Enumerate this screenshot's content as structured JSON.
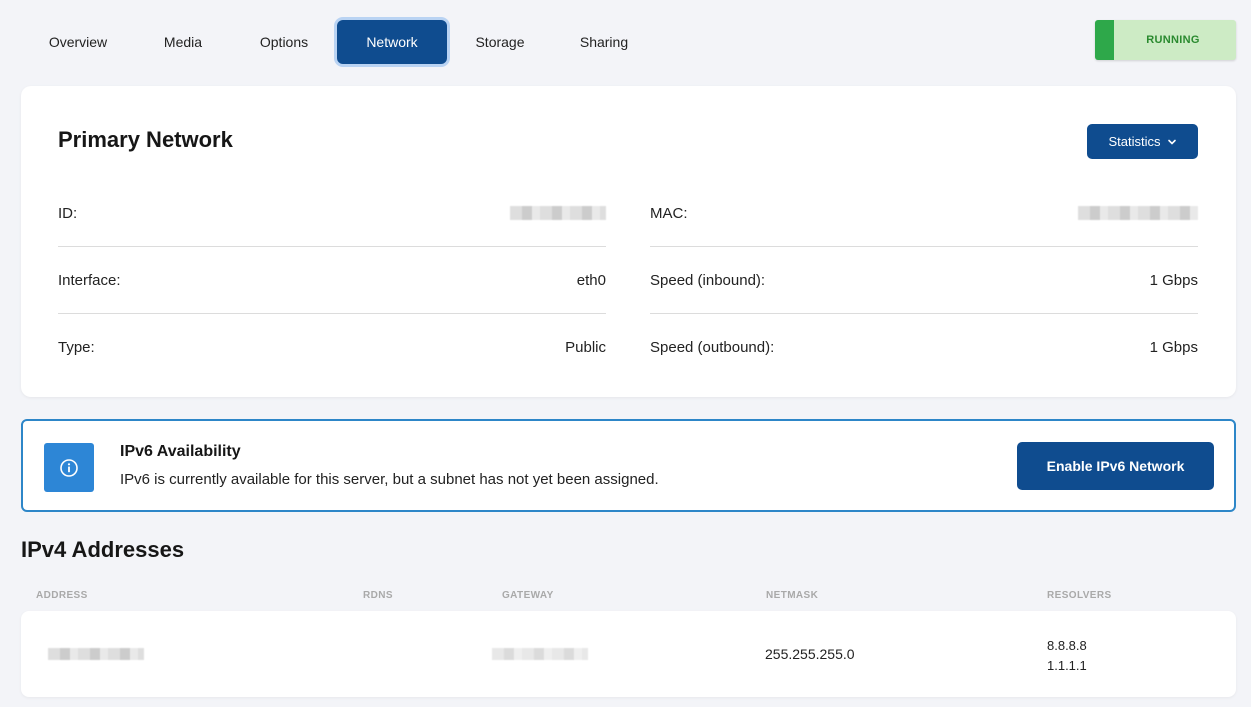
{
  "tabs": [
    {
      "label": "Overview",
      "active": false
    },
    {
      "label": "Media",
      "active": false
    },
    {
      "label": "Options",
      "active": false
    },
    {
      "label": "Network",
      "active": true
    },
    {
      "label": "Storage",
      "active": false
    },
    {
      "label": "Sharing",
      "active": false
    }
  ],
  "status": {
    "label": "RUNNING",
    "color": "#2ea84a"
  },
  "primary_network": {
    "title": "Primary Network",
    "statistics_label": "Statistics",
    "left_rows": [
      {
        "label": "ID:",
        "value": ""
      },
      {
        "label": "Interface:",
        "value": "eth0"
      },
      {
        "label": "Type:",
        "value": "Public"
      }
    ],
    "right_rows": [
      {
        "label": "MAC:",
        "value": ""
      },
      {
        "label": "Speed (inbound):",
        "value": "1 Gbps"
      },
      {
        "label": "Speed (outbound):",
        "value": "1 Gbps"
      }
    ]
  },
  "ipv6": {
    "title": "IPv6 Availability",
    "text": "IPv6 is currently available for this server, but a subnet has not yet been assigned.",
    "button_label": "Enable IPv6 Network"
  },
  "ipv4": {
    "title": "IPv4 Addresses",
    "columns": [
      "ADDRESS",
      "RDNS",
      "GATEWAY",
      "NETMASK",
      "RESOLVERS"
    ],
    "rows": [
      {
        "address": "",
        "rdns": "",
        "gateway": "",
        "netmask": "255.255.255.0",
        "resolvers": [
          "8.8.8.8",
          "1.1.1.1"
        ]
      }
    ]
  },
  "colors": {
    "accent": "#0f4c8f",
    "info": "#2d86d6",
    "status_bg": "#cdebc5"
  }
}
